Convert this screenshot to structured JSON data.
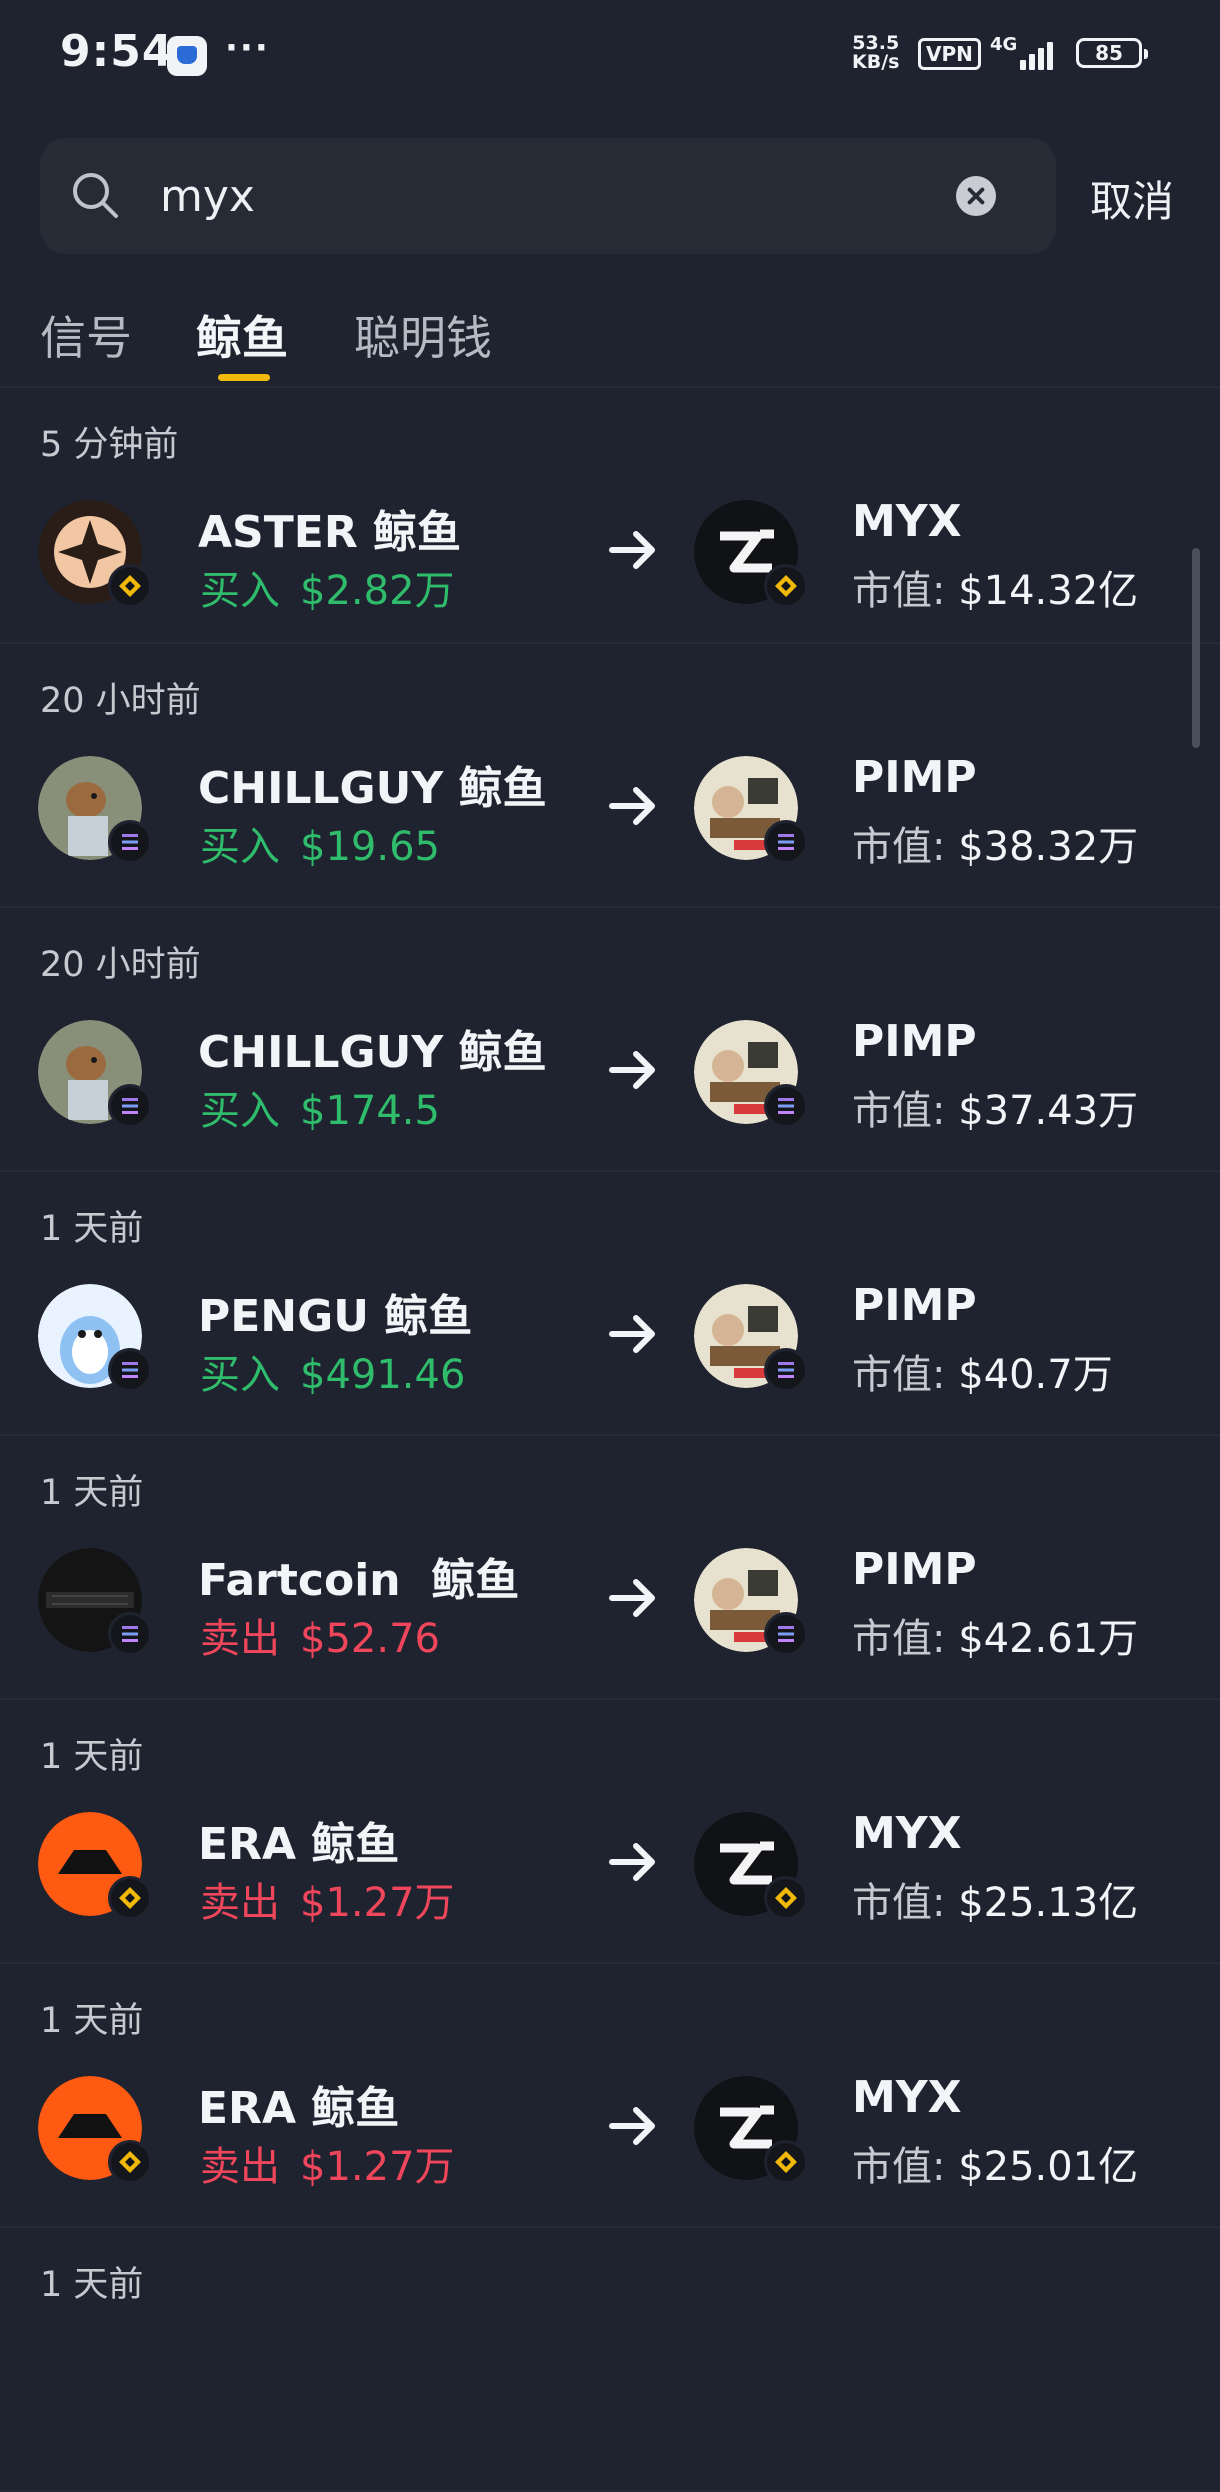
{
  "status_bar": {
    "time": "9:54",
    "more": "···",
    "speed_value": "53.5",
    "speed_unit": "KB/s",
    "vpn": "VPN",
    "network": "4G",
    "battery": "85"
  },
  "search": {
    "query": "myx",
    "cancel_label": "取消"
  },
  "tabs": [
    {
      "label": "信号",
      "active": false
    },
    {
      "label": "鲸鱼",
      "active": true
    },
    {
      "label": "聪明钱",
      "active": false
    }
  ],
  "entries": [
    {
      "time_ago": "5 分钟前",
      "whale": "ASTER 鲸鱼",
      "side": "买入",
      "amount": "$2.82万",
      "token": "MYX",
      "mcap_label": "市值:",
      "mcap": "$14.32亿",
      "whale_chain": "bnb",
      "token_chain": "bnb"
    },
    {
      "time_ago": "20 小时前",
      "whale": "CHILLGUY 鲸鱼",
      "side": "买入",
      "amount": "$19.65",
      "token": "PIMP",
      "mcap_label": "市值:",
      "mcap": "$38.32万",
      "whale_chain": "solana",
      "token_chain": "solana"
    },
    {
      "time_ago": "20 小时前",
      "whale": "CHILLGUY 鲸鱼",
      "side": "买入",
      "amount": "$174.5",
      "token": "PIMP",
      "mcap_label": "市值:",
      "mcap": "$37.43万",
      "whale_chain": "solana",
      "token_chain": "solana"
    },
    {
      "time_ago": "1 天前",
      "whale": "PENGU 鲸鱼",
      "side": "买入",
      "amount": "$491.46",
      "token": "PIMP",
      "mcap_label": "市值:",
      "mcap": "$40.7万",
      "whale_chain": "solana",
      "token_chain": "solana"
    },
    {
      "time_ago": "1 天前",
      "whale": "Fartcoin  鲸鱼",
      "side": "卖出",
      "amount": "$52.76",
      "token": "PIMP",
      "mcap_label": "市值:",
      "mcap": "$42.61万",
      "whale_chain": "solana",
      "token_chain": "solana"
    },
    {
      "time_ago": "1 天前",
      "whale": "ERA 鲸鱼",
      "side": "卖出",
      "amount": "$1.27万",
      "token": "MYX",
      "mcap_label": "市值:",
      "mcap": "$25.13亿",
      "whale_chain": "bnb",
      "token_chain": "bnb"
    },
    {
      "time_ago": "1 天前",
      "whale": "ERA 鲸鱼",
      "side": "卖出",
      "amount": "$1.27万",
      "token": "MYX",
      "mcap_label": "市值:",
      "mcap": "$25.01亿",
      "whale_chain": "bnb",
      "token_chain": "bnb"
    },
    {
      "time_ago": "1 天前"
    }
  ],
  "colors": {
    "background": "#1f232f",
    "buy": "#2fbd6b",
    "sell": "#f0465b",
    "tab_indicator": "#f0b90b",
    "bnb": "#f0b90b"
  },
  "icons": {
    "search": "search-icon",
    "clear": "clear-icon",
    "arrow": "arrow-right-icon",
    "bnb": "bnb-chain-icon",
    "solana": "solana-chain-icon"
  }
}
